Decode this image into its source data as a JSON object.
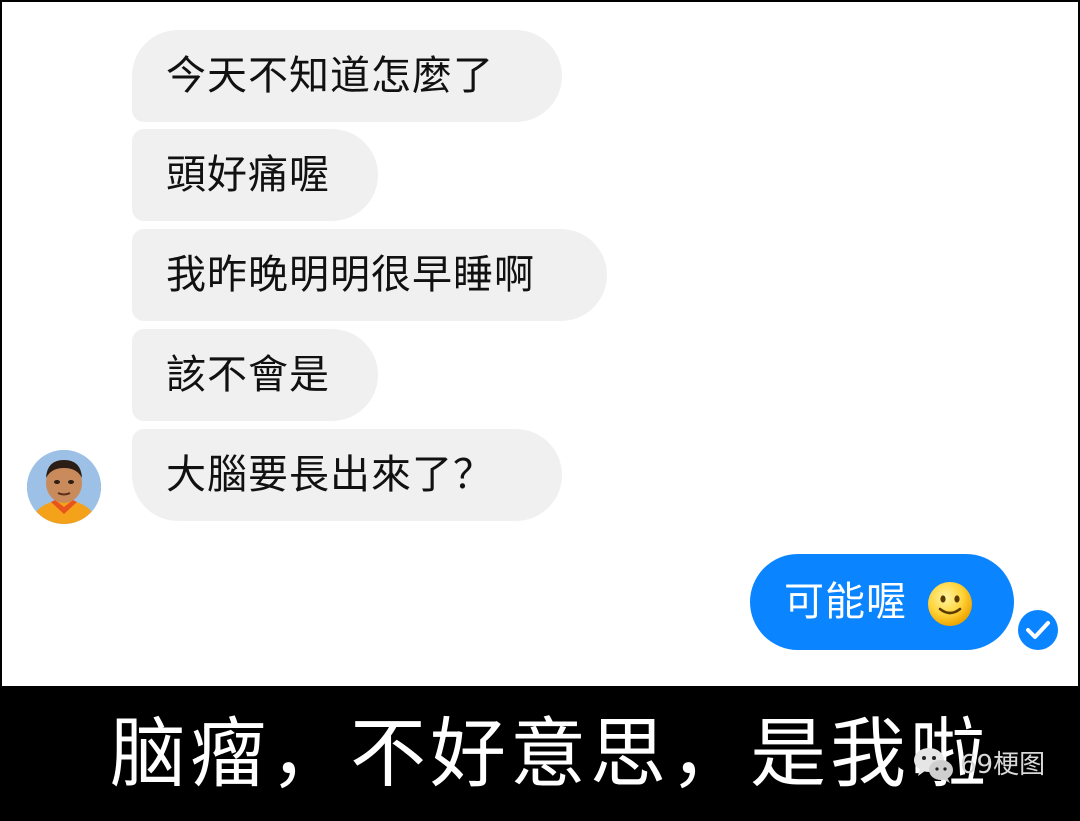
{
  "conversation": {
    "incoming": [
      {
        "text": "今天不知道怎麼了"
      },
      {
        "text": "頭好痛喔"
      },
      {
        "text": "我昨晚明明很早睡啊"
      },
      {
        "text": "該不會是"
      },
      {
        "text": "大腦要長出來了？"
      }
    ],
    "outgoing": {
      "text": "可能喔",
      "emoji_icon": "slightly-smiling-face-icon",
      "status_icon": "read-checkmark-icon"
    }
  },
  "caption": {
    "text": "脑瘤，不好意思，是我啦"
  },
  "watermark": {
    "icon": "wechat-icon",
    "text": "69梗图"
  },
  "colors": {
    "incoming_bubble": "#f1f0f0",
    "outgoing_bubble": "#0a84ff",
    "caption_background": "#000000",
    "caption_text": "#ffffff"
  }
}
